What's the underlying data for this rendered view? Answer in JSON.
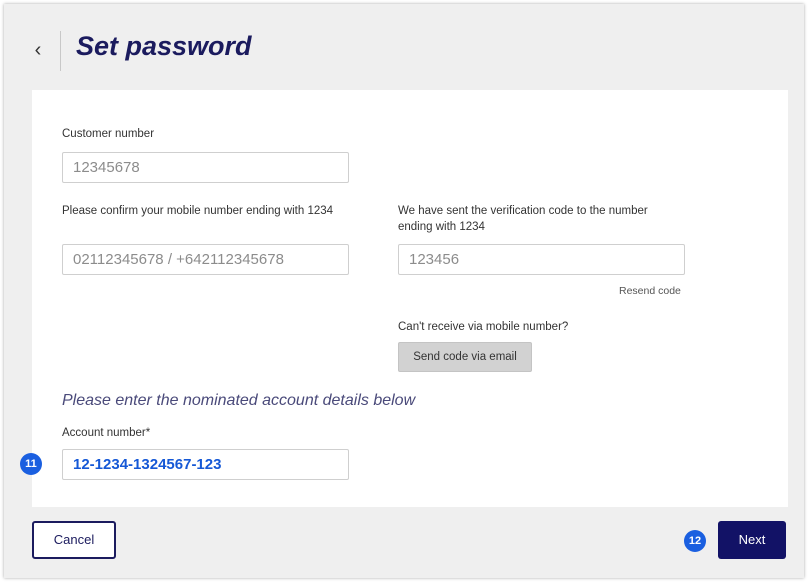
{
  "header": {
    "back_icon": "chevron-left-icon",
    "back_glyph": "‹",
    "title": "Set password"
  },
  "form": {
    "customer_number": {
      "label": "Customer number",
      "placeholder": "12345678"
    },
    "mobile": {
      "label": "Please confirm your mobile number ending with 1234",
      "placeholder": "02112345678 / +642112345678"
    },
    "verification": {
      "label": "We have sent the verification code to the number ending with 1234",
      "placeholder": "123456",
      "resend_label": "Resend code"
    },
    "email_option": {
      "label": "Can't receive via mobile number?",
      "button_label": "Send code via email"
    },
    "nominated_heading": "Please enter the nominated account details below",
    "account_number": {
      "label": "Account number*",
      "value": "12-1234-1324567-123",
      "step": "11"
    }
  },
  "footer": {
    "cancel_label": "Cancel",
    "next_label": "Next",
    "next_step": "12"
  },
  "colors": {
    "title": "#1b1b5e",
    "primary_button": "#121266",
    "step_badge": "#1a5fe0",
    "filled_value": "#1558d6"
  }
}
